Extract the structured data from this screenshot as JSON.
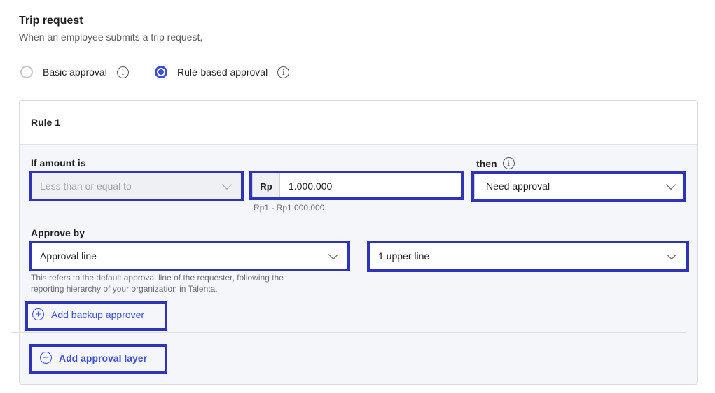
{
  "header": {
    "title": "Trip request",
    "subtitle": "When an employee submits a trip request,"
  },
  "approval_type": {
    "options": [
      {
        "label": "Basic approval",
        "selected": false
      },
      {
        "label": "Rule-based approval",
        "selected": true
      }
    ],
    "info_glyph": "i"
  },
  "rule": {
    "title": "Rule 1",
    "amount_label": "If amount is",
    "condition": "Less than or equal to",
    "currency_prefix": "Rp",
    "amount_value": "1.000.000",
    "amount_hint": "Rp1 - Rp1.000.000",
    "then_label": "then",
    "then_value": "Need approval",
    "approve_by_label": "Approve by",
    "approve_by_value": "Approval line",
    "approve_by_hint_1": "This refers to the default approval line of the requester, following the",
    "approve_by_hint_2": "reporting hierarchy of your organization in Talenta.",
    "level_value": "1 upper line",
    "add_backup_label": "Add backup approver",
    "add_layer_label": "Add approval layer"
  },
  "colors": {
    "accent": "#3b4fd8",
    "highlight": "#2f33b8",
    "panel_bg": "#f4f6f9"
  }
}
